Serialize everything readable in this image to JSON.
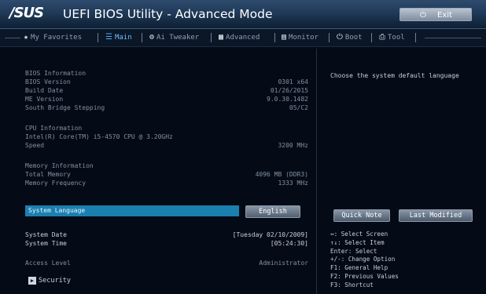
{
  "header": {
    "logo_text": "/SUS",
    "title": "UEFI BIOS Utility - Advanced Mode",
    "exit_label": "Exit",
    "exit_icon": "power-icon"
  },
  "tabs": [
    {
      "label": "My Favorites",
      "icon": "star-icon"
    },
    {
      "label": "Main",
      "icon": "list-icon",
      "active": true
    },
    {
      "label": "Ai Tweaker",
      "icon": "tweaker-icon"
    },
    {
      "label": "Advanced",
      "icon": "advanced-icon"
    },
    {
      "label": "Monitor",
      "icon": "monitor-icon"
    },
    {
      "label": "Boot",
      "icon": "power-icon"
    },
    {
      "label": "Tool",
      "icon": "printer-icon"
    }
  ],
  "main": {
    "bios_heading": "BIOS Information",
    "bios_version_label": "BIOS Version",
    "bios_version_value": "0301 x64",
    "build_date_label": "Build Date",
    "build_date_value": "01/26/2015",
    "me_version_label": "ME Version",
    "me_version_value": "9.0.30.1482",
    "south_bridge_label": "South Bridge Stepping",
    "south_bridge_value": "05/C2",
    "cpu_heading": "CPU Information",
    "cpu_model": "Intel(R) Core(TM) i5-4570 CPU @ 3.20GHz",
    "speed_label": "Speed",
    "speed_value": "3200 MHz",
    "memory_heading": "Memory Information",
    "total_memory_label": "Total Memory",
    "total_memory_value": "4096 MB (DDR3)",
    "memory_freq_label": "Memory Frequency",
    "memory_freq_value": "1333 MHz",
    "system_language_label": "System Language",
    "system_language_value": "English",
    "system_date_label": "System Date",
    "system_date_value": "[Tuesday 02/10/2009]",
    "system_time_label": "System Time",
    "system_time_value": "[05:24:30]",
    "access_level_label": "Access Level",
    "access_level_value": "Administrator",
    "security_label": "Security"
  },
  "help": {
    "description": "Choose the system default language",
    "quick_note_label": "Quick Note",
    "last_modified_label": "Last Modified",
    "keys": [
      "↔: Select Screen",
      "↑↓: Select Item",
      "Enter: Select",
      "+/-: Change Option",
      "F1: General Help",
      "F2: Previous Values",
      "F3: Shortcut"
    ]
  },
  "colors": {
    "accent": "#1b7fb0",
    "active_tab": "#66c2ff",
    "background": "#050b16"
  }
}
